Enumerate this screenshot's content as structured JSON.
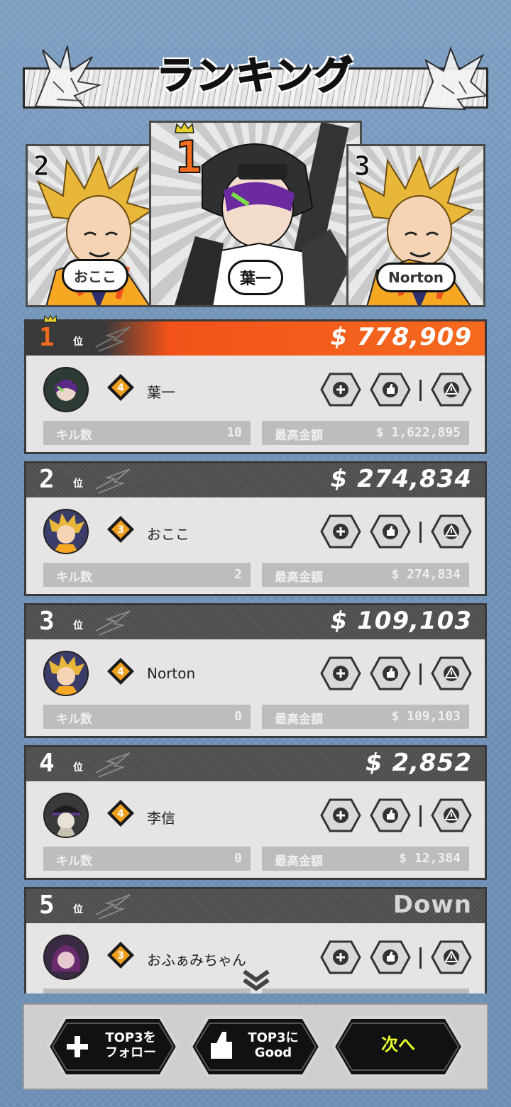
{
  "title": "ランキング",
  "podium": [
    {
      "rank": "2",
      "name": "おここ"
    },
    {
      "rank": "1",
      "name": "葉一"
    },
    {
      "rank": "3",
      "name": "Norton"
    }
  ],
  "rank_suffix": "位",
  "stat_labels": {
    "kills": "キル数",
    "best": "最高金額"
  },
  "rows": [
    {
      "rank": "1",
      "amount": "$ 778,909",
      "name": "葉一",
      "level": "4",
      "kills": "10",
      "best": "$ 1,622,895"
    },
    {
      "rank": "2",
      "amount": "$ 274,834",
      "name": "おここ",
      "level": "3",
      "kills": "2",
      "best": "$ 274,834"
    },
    {
      "rank": "3",
      "amount": "$ 109,103",
      "name": "Norton",
      "level": "4",
      "kills": "0",
      "best": "$ 109,103"
    },
    {
      "rank": "4",
      "amount": "$ 2,852",
      "name": "李信",
      "level": "4",
      "kills": "0",
      "best": "$ 12,384"
    },
    {
      "rank": "5",
      "amount": "Down",
      "name": "おふぁみちゃん",
      "level": "3"
    }
  ],
  "buttons": {
    "follow_line1": "TOP3を",
    "follow_line2": "フォロー",
    "good_line1": "TOP3に",
    "good_line2": "Good",
    "next": "次へ"
  },
  "colors": {
    "accent": "#f36b1e",
    "next_text": "#e8ff2a",
    "header_dark": "#4a4a4a"
  }
}
